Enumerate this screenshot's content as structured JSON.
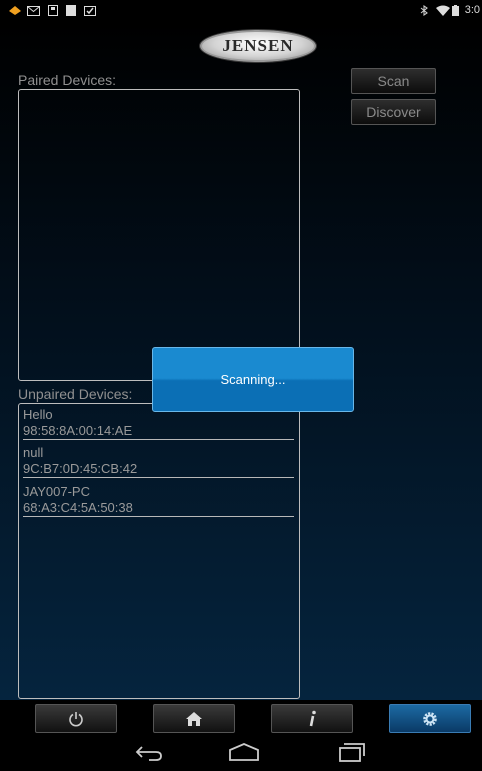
{
  "status_bar": {
    "time": "3:0",
    "left_icons": [
      "notification-icon",
      "mail-icon",
      "sd-card-icon",
      "image-icon",
      "clipboard-icon"
    ],
    "right_icons": [
      "bluetooth-icon",
      "wifi-icon",
      "battery-icon"
    ]
  },
  "app": {
    "brand": "JENSEN",
    "paired_label": "Paired Devices:",
    "unpaired_label": "Unpaired Devices:",
    "scan_label": "Scan",
    "discover_label": "Discover",
    "unpaired_devices": [
      {
        "name": "Hello",
        "address": "98:58:8A:00:14:AE"
      },
      {
        "name": "null",
        "address": "9C:B7:0D:45:CB:42"
      },
      {
        "name": "JAY007-PC",
        "address": "68:A3:C4:5A:50:38"
      }
    ]
  },
  "dialog": {
    "message": "Scanning..."
  },
  "bottom_nav": {
    "items": [
      {
        "icon": "power-icon"
      },
      {
        "icon": "home-icon"
      },
      {
        "icon": "info-icon"
      },
      {
        "icon": "settings-gear-icon",
        "active": true
      }
    ]
  },
  "system_nav": {
    "items": [
      "back-icon",
      "home-outline-icon",
      "recent-apps-icon"
    ]
  },
  "colors": {
    "accent": "#1a8ad0",
    "active_nav": "#1c6aa3"
  }
}
